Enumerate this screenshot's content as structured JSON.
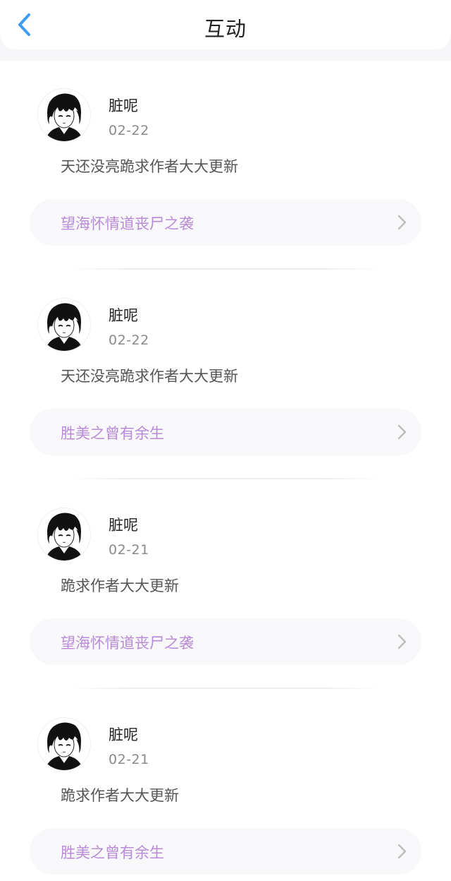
{
  "header": {
    "title": "互动",
    "back_icon": "chevron-left-icon",
    "accent_color": "#3d9df3"
  },
  "items": [
    {
      "username": "脏呢",
      "date": "02-22",
      "comment": "天还没亮跪求作者大大更新",
      "book_title": "望海怀情道丧尸之袭",
      "avatar_icon": "anime-avatar-icon"
    },
    {
      "username": "脏呢",
      "date": "02-22",
      "comment": "天还没亮跪求作者大大更新",
      "book_title": "胜美之曾有余生",
      "avatar_icon": "anime-avatar-icon"
    },
    {
      "username": "脏呢",
      "date": "02-21",
      "comment": "跪求作者大大更新",
      "book_title": "望海怀情道丧尸之袭",
      "avatar_icon": "anime-avatar-icon"
    },
    {
      "username": "脏呢",
      "date": "02-21",
      "comment": "跪求作者大大更新",
      "book_title": "胜美之曾有余生",
      "avatar_icon": "anime-avatar-icon"
    }
  ],
  "colors": {
    "book_title": "#b98ad8",
    "date": "#8a8a8a",
    "comment": "#555555"
  }
}
